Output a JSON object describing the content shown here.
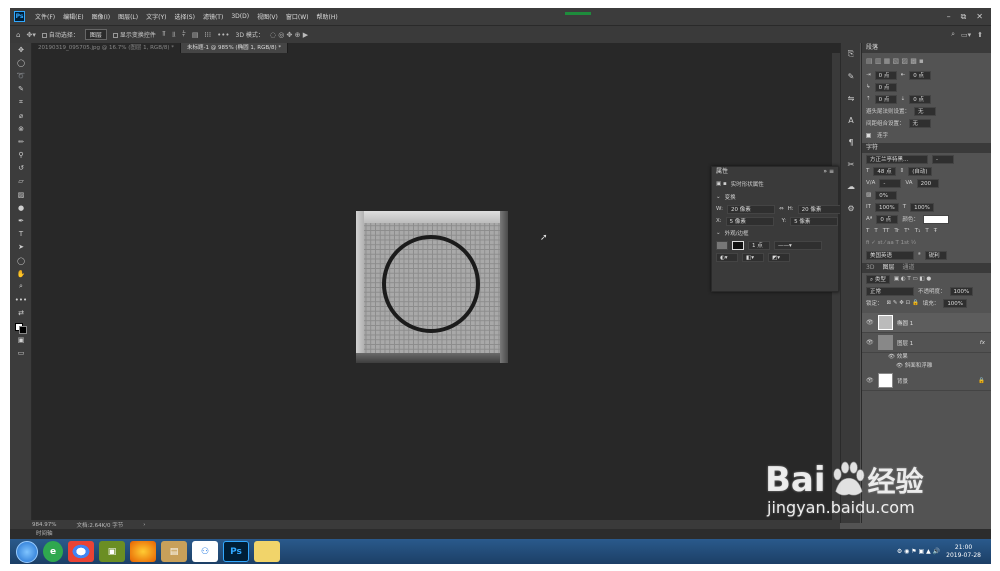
{
  "menubar": {
    "app_badge": "Ps",
    "items": [
      "文件(F)",
      "编辑(E)",
      "图像(I)",
      "图层(L)",
      "文字(Y)",
      "选择(S)",
      "滤镜(T)",
      "3D(D)",
      "视图(V)",
      "窗口(W)",
      "帮助(H)"
    ],
    "win_controls": [
      "–",
      "⧉",
      "✕"
    ]
  },
  "options": {
    "auto_select_label": "自动选择：",
    "auto_select_value": "图层",
    "show_transform_label": "显示变换控件",
    "mode3d_label": "3D 模式："
  },
  "tabs": [
    {
      "label": "20190319_095705.jpg @ 16.7% (图层 1, RGB/8) *"
    },
    {
      "label": "未标题-1 @ 985% (椭圆 1, RGB/8) *"
    }
  ],
  "paragraph": {
    "title": "段落",
    "rows": [
      {
        "a": "0 点",
        "b": "0 点"
      },
      {
        "a": "0 点"
      },
      {
        "a": "0 点",
        "b": "0 点"
      }
    ],
    "kinsoku_label": "避头尾法则设置：",
    "kinsoku_value": "无",
    "spacing_label": "间距组合设置：",
    "spacing_value": "无",
    "hyphen_label": "连字"
  },
  "character": {
    "title": "字符",
    "font": "方正兰亭特黑...",
    "size": "48 点",
    "leading": "(自动)",
    "tracking": "200",
    "scale_pct": "0%",
    "vscale": "100%",
    "hscale": "100%",
    "baseline": "0 点",
    "color_label": "颜色：",
    "lang": "美国英语",
    "aa": "锐利",
    "style_glyphs": [
      "T",
      "T",
      "TT",
      "Tr",
      "T¹",
      "T₁",
      "T",
      "Ŧ"
    ]
  },
  "properties": {
    "title": "属性",
    "subtitle": "实时形状属性",
    "section_transform": "变换",
    "w_label": "W:",
    "w": "20 像素",
    "h_label": "H:",
    "h": "20 像素",
    "x_label": "X:",
    "x": "5 像素",
    "y_label": "Y:",
    "y": "5 像素",
    "section_appearance": "外观/边框",
    "stroke": "1 点"
  },
  "layers": {
    "tabs": [
      "3D",
      "图层",
      "通道"
    ],
    "filter": "类型",
    "blend": "正常",
    "opacity_label": "不透明度：",
    "opacity": "100%",
    "lock_label": "锁定：",
    "fill_label": "填充：",
    "fill": "100%",
    "items": [
      {
        "name": "椭圆 1",
        "active": true
      },
      {
        "name": "图层 1",
        "fx": "fx",
        "effects_label": "效果",
        "effect": "斜面和浮雕"
      },
      {
        "name": "背景",
        "lock": "🔒"
      }
    ]
  },
  "status": {
    "zoom": "984.97%",
    "doc": "文档:2.64K/0 字节"
  },
  "timeline": {
    "label": "时间轴"
  },
  "taskbar": {
    "apps": [
      "e",
      "◉",
      "▣",
      "◐",
      "▤",
      "⚇",
      "Ps",
      "▭"
    ],
    "ps_label": "Ps",
    "time": "21:00",
    "date": "2019-07-28"
  },
  "watermark": {
    "brand_left": "Bai",
    "brand_right": "经验",
    "url": "jingyan.baidu.com"
  }
}
